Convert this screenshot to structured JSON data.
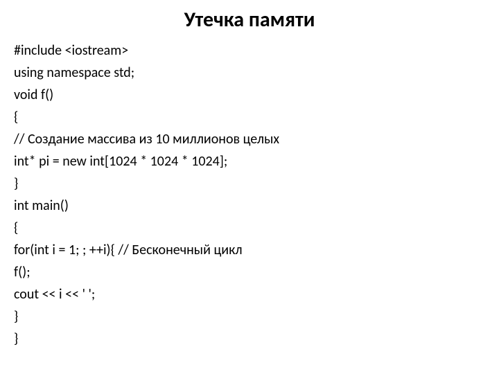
{
  "title": "Утечка памяти",
  "code": {
    "line1": "#include <iostream>",
    "line2": "using namespace std;",
    "line3": "void f()",
    "line4": "{",
    "line5": "// Создание массива из 10 миллионов целых",
    "line6": "int* pi = new int[1024 * 1024 * 1024];",
    "line7": "}",
    "line8": "int main()",
    "line9": "{",
    "line10": "for(int i = 1; ; ++i){ // Бесконечный цикл",
    "line11": "f();",
    "line12": "cout << i << ' ';",
    "line13": "}",
    "line14": "}"
  }
}
